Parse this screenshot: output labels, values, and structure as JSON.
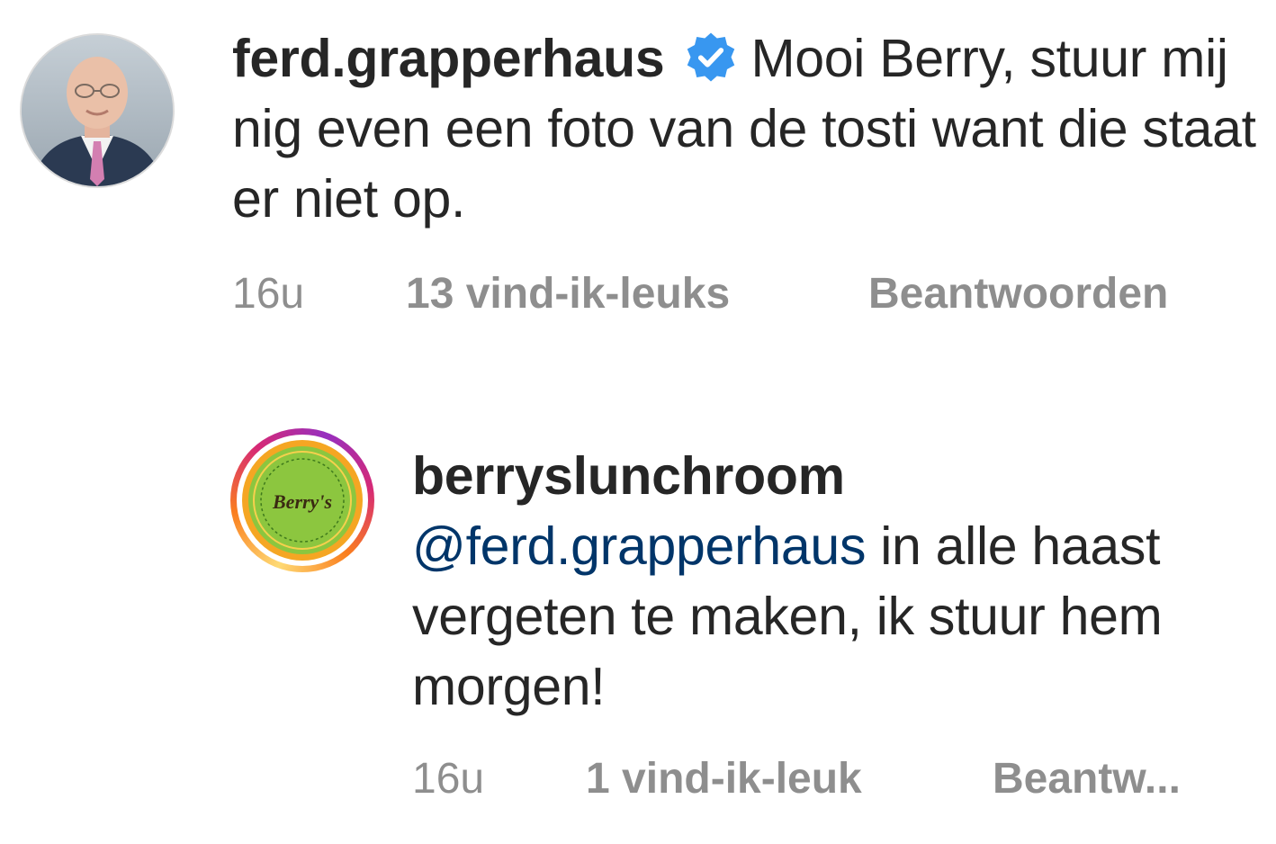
{
  "comments": [
    {
      "username": "ferd.grapperhaus",
      "verified": true,
      "text": "Mooi Berry, stuur mij nig even een foto van de tosti want die staat er niet op.",
      "time": "16u",
      "likes": "13 vind-ik-leuks",
      "reply": "Beantwoorden"
    },
    {
      "username": "berryslunchroom",
      "mention": "@ferd.grapperhaus",
      "text": " in alle haast vergeten te maken, ik stuur hem morgen!",
      "time": "16u",
      "likes": "1 vind-ik-leuk",
      "reply": "Beantw..."
    }
  ],
  "avatars": {
    "first": "portrait-photo",
    "second_logo_text": "Berry's"
  },
  "colors": {
    "text": "#262626",
    "meta": "#8e8e8e",
    "mention": "#003569",
    "verified": "#3897f0"
  }
}
